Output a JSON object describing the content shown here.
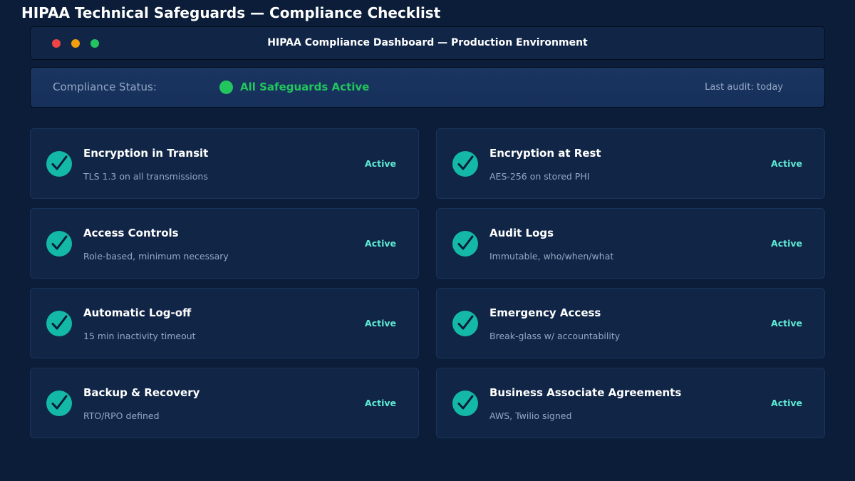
{
  "page": {
    "title": "HIPAA Technical Safeguards — Compliance Checklist"
  },
  "window": {
    "title": "HIPAA Compliance Dashboard — Production Environment",
    "controls": [
      "close",
      "minimize",
      "maximize"
    ]
  },
  "status": {
    "label": "Compliance Status:",
    "value": "All Safeguards Active",
    "last_audit": "Last audit: today"
  },
  "colors": {
    "background": "#0b1d38",
    "card": "#112647",
    "accent_teal": "#14b8a6",
    "status_green": "#22c55e",
    "active_text": "#5eead4"
  },
  "safeguards": [
    {
      "title": "Encryption in Transit",
      "description": "TLS 1.3 on all transmissions",
      "status": "Active",
      "icon": "check-circle-icon"
    },
    {
      "title": "Encryption at Rest",
      "description": "AES-256 on stored PHI",
      "status": "Active",
      "icon": "check-circle-icon"
    },
    {
      "title": "Access Controls",
      "description": "Role-based, minimum necessary",
      "status": "Active",
      "icon": "check-circle-icon"
    },
    {
      "title": "Audit Logs",
      "description": "Immutable, who/when/what",
      "status": "Active",
      "icon": "check-circle-icon"
    },
    {
      "title": "Automatic Log-off",
      "description": "15 min inactivity timeout",
      "status": "Active",
      "icon": "check-circle-icon"
    },
    {
      "title": "Emergency Access",
      "description": "Break-glass w/ accountability",
      "status": "Active",
      "icon": "check-circle-icon"
    },
    {
      "title": "Backup & Recovery",
      "description": "RTO/RPO defined",
      "status": "Active",
      "icon": "check-circle-icon"
    },
    {
      "title": "Business Associate Agreements",
      "description": "AWS, Twilio signed",
      "status": "Active",
      "icon": "check-circle-icon"
    }
  ]
}
